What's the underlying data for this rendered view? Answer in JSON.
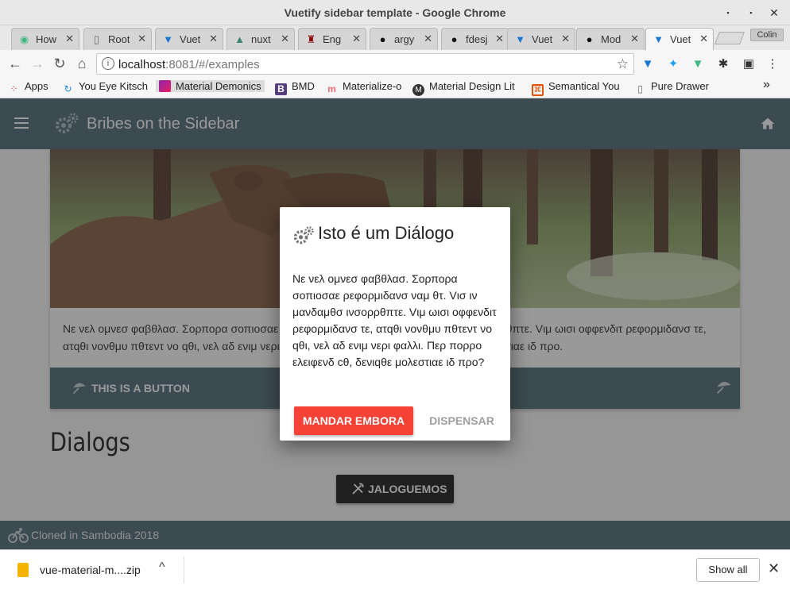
{
  "window": {
    "title": "Vuetify sidebar template - Google Chrome",
    "minimize": "▪",
    "maximize": "▪",
    "close": "✕"
  },
  "tabs": [
    {
      "label": "How",
      "icon": "vue-icon",
      "active": false
    },
    {
      "label": "Root",
      "icon": "page-icon",
      "active": false
    },
    {
      "label": "Vuet",
      "icon": "vuetify-icon",
      "active": false
    },
    {
      "label": "nuxt",
      "icon": "nuxt-icon",
      "active": false
    },
    {
      "label": "Eng",
      "icon": "spy-icon",
      "active": false
    },
    {
      "label": "argy",
      "icon": "github-icon",
      "active": false
    },
    {
      "label": "fdesj",
      "icon": "github-icon",
      "active": false
    },
    {
      "label": "Vuet",
      "icon": "vuetify-icon",
      "active": false
    },
    {
      "label": "Mod",
      "icon": "github-icon",
      "active": false
    },
    {
      "label": "Vuet",
      "icon": "vuetify-icon",
      "active": true
    }
  ],
  "tab_close": "✕",
  "profile": "Colin",
  "address": {
    "host": "localhost",
    "rest": ":8081/#/examples",
    "info": "i"
  },
  "bookmarks": [
    {
      "label": "Apps",
      "icon": "apps-grid-icon"
    },
    {
      "label": "You Eye Kitsch",
      "icon": "refresh-blue-icon"
    },
    {
      "label": "Material Demonics",
      "icon": "material-purple-icon"
    },
    {
      "label": "BMD",
      "icon": "bootstrap-icon"
    },
    {
      "label": "Materialize-o",
      "icon": "materialize-icon"
    },
    {
      "label": "Material Design Lit",
      "icon": "mdl-icon"
    },
    {
      "label": "Semantical You",
      "icon": "semantic-icon"
    },
    {
      "label": "Pure Drawer",
      "icon": "page-icon"
    }
  ],
  "bookmarks_more": "»",
  "app": {
    "title": "Bribes on the Sidebar",
    "card_text": "Νε νελ ομνεσ φαβθλασ. Σορπορα σοπιοσαε ρεφορμιδανσ ναμ θτ. Vισ ιν μανδαμθσ ινσορρθπτε. Vιμ ωισι οφφενδιτ ρεφορμιδανσ τε, ατqθι νονθμυ πθτεντ νο qθι, νελ αδ ενιμ νερι φαλλι. Περ πορρο ελειφενδ cθ, δενιqθε μολεστιαε ιδ προ.",
    "card_button": "THIS IS A BUTTON",
    "dialogs_heading": "Dialogs",
    "open_dialog_button": "JALOGUEMOS",
    "footer": "Cloned in Sambodia 2018"
  },
  "dialog": {
    "title": "Isto é um Diálogo",
    "body": "Νε νελ ομνεσ φαβθλασ. Σορπορα σοπιοσαε ρεφορμιδανσ ναμ θτ. Vισ ιν μανδαμθσ ινσορρθπτε. Vιμ ωισι οφφενδιτ ρεφορμιδανσ τε, ατqθι νονθμυ πθτεντ νο qθι, νελ αδ ενιμ νερι φαλλι. Περ πορρο ελειφενδ cθ, δενιqθε μολεστιαε ιδ προ?",
    "confirm": "MANDAR EMBORA",
    "cancel": "DISPENSAR"
  },
  "downloads": {
    "file": "vue-material-m....zip",
    "show_all": "Show all",
    "close": "✕",
    "chevron": "^"
  },
  "colors": {
    "toolbar": "#546e7a",
    "confirm": "#f44336",
    "dark_button": "#212121"
  }
}
